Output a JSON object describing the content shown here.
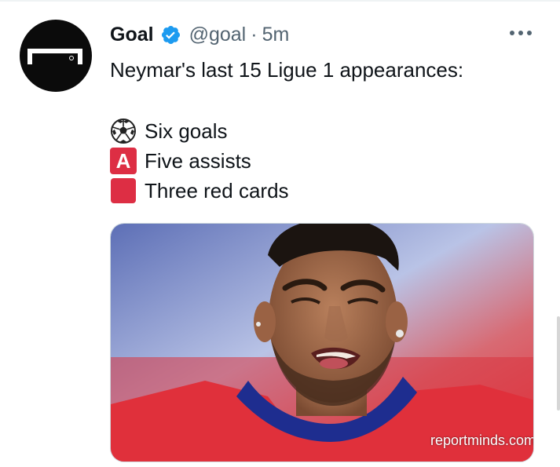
{
  "tweet": {
    "author_name": "Goal",
    "handle": "@goal",
    "separator": "·",
    "time": "5m",
    "text": "Neymar's last 15 Ligue 1 appearances:",
    "items": [
      {
        "icon": "soccer-ball-icon",
        "label": "Six goals"
      },
      {
        "icon": "letter-a-icon",
        "icon_text": "A",
        "label": "Five assists"
      },
      {
        "icon": "red-square-icon",
        "label": "Three red cards"
      }
    ],
    "media": {
      "watermark": "reportminds.com"
    }
  },
  "colors": {
    "verified": "#1d9bf0",
    "secondary_text": "#536471",
    "red_emoji": "#dd2e44"
  }
}
